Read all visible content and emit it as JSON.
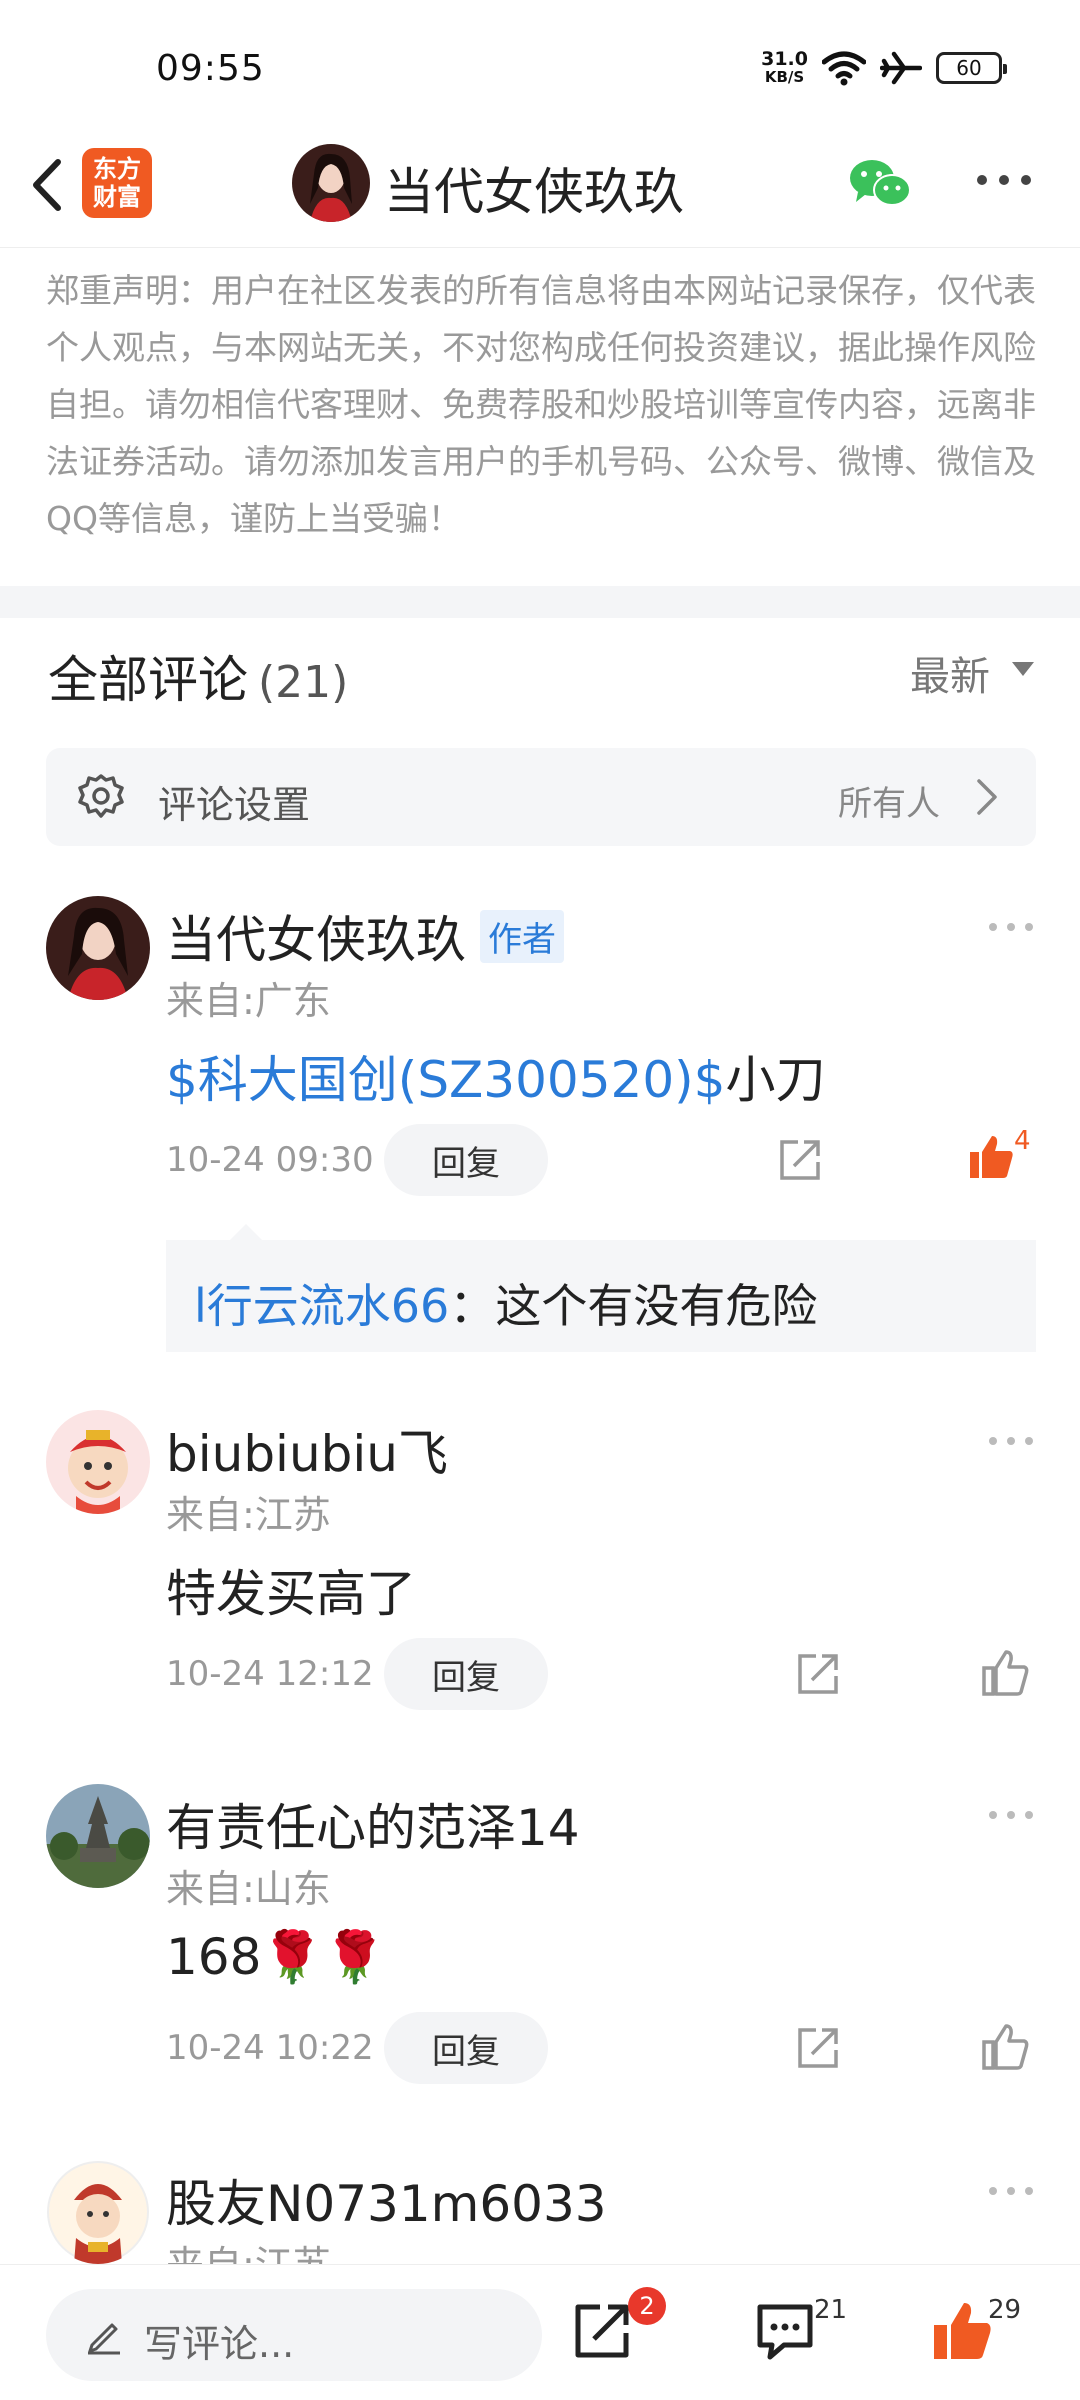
{
  "status_bar": {
    "time": "09:55",
    "net_speed_value": "31.0",
    "net_speed_unit": "KB/S",
    "battery": "60"
  },
  "header": {
    "brand_line1": "东方",
    "brand_line2": "财富",
    "title": "当代女侠玖玖"
  },
  "disclaimer": "郑重声明：用户在社区发表的所有信息将由本网站记录保存，仅代表个人观点，与本网站无关，不对您构成任何投资建议，据此操作风险自担。请勿相信代客理财、免费荐股和炒股培训等宣传内容，远离非法证券活动。请勿添加发言用户的手机号码、公众号、微博、微信及QQ等信息，谨防上当受骗！",
  "comments_header": {
    "title": "全部评论",
    "count": "(21)",
    "sort": "最新"
  },
  "settings": {
    "label": "评论设置",
    "value": "所有人"
  },
  "comments": [
    {
      "name": "当代女侠玖玖",
      "badge": "作者",
      "location": "来自:广东",
      "text_link": "$科大国创(SZ300520)$",
      "text": "小刀",
      "time": "10-24 09:30",
      "reply": "回复",
      "likes": "4",
      "sub_reply": {
        "user": "l行云流水66",
        "text": "：这个有没有危险"
      }
    },
    {
      "name": "biubiubiu飞",
      "location": "来自:江苏",
      "text": "特发买高了",
      "time": "10-24 12:12",
      "reply": "回复"
    },
    {
      "name": "有责任心的范泽14",
      "location": "来自:山东",
      "text": "168🌹🌹",
      "time": "10-24 10:22",
      "reply": "回复"
    },
    {
      "name": "股友N0731m6033",
      "location": "来自:江苏"
    }
  ],
  "bottom_bar": {
    "placeholder": "写评论...",
    "share_badge": "2",
    "comment_count": "21",
    "like_count": "29"
  },
  "colors": {
    "accent_blue": "#2a7bd8",
    "accent_orange": "#f05a22",
    "badge_red": "#e8382b"
  }
}
